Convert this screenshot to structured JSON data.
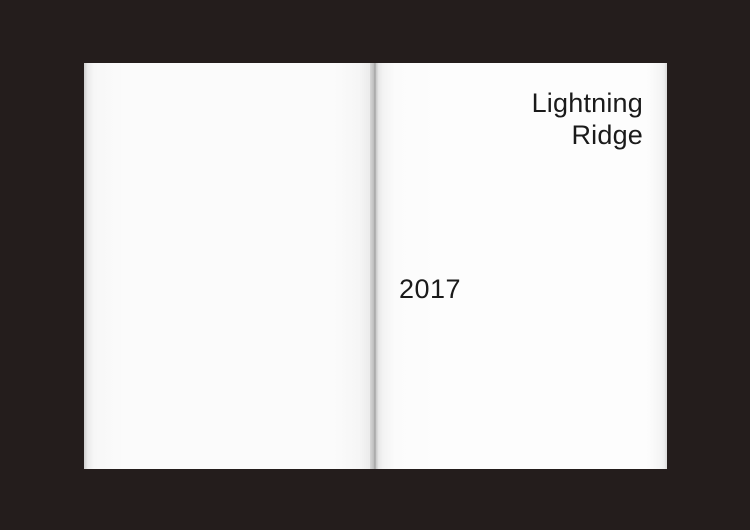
{
  "colors": {
    "background": "#241d1c",
    "paper": "#fdfdfd",
    "ink": "#1a1a1a"
  },
  "book": {
    "right_page": {
      "title_lines": [
        "Lightning",
        "Ridge"
      ],
      "year": "2017"
    }
  }
}
